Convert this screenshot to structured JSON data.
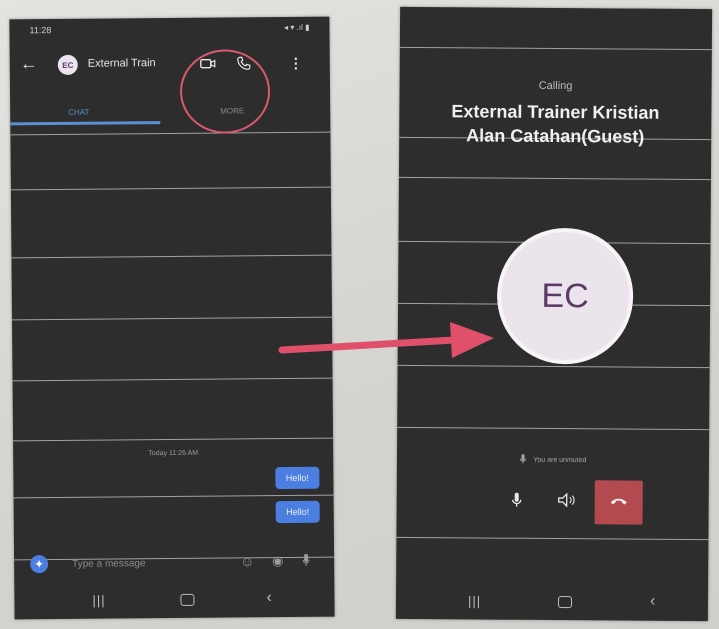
{
  "chat_screen": {
    "status_time": "11:28",
    "status_icons": "◂ ▾ .ıl ▮",
    "avatar_initials": "EC",
    "contact_name": "External Train",
    "tabs": [
      {
        "label": "CHAT"
      },
      {
        "label": "MORE"
      }
    ],
    "date_label": "Today 11:26 AM",
    "messages": [
      {
        "text": "Hello!"
      },
      {
        "text": "Hello!"
      }
    ],
    "composer_placeholder": "Type a message"
  },
  "call_screen": {
    "status_text": "Calling",
    "callee_line1": "External Trainer Kristian",
    "callee_line2": "Alan Catahan(Guest)",
    "avatar_initials": "EC",
    "mute_status": "You are unmuted"
  },
  "colors": {
    "accent_blue": "#4a7ee0",
    "highlight_red": "#d95a6c",
    "arrow_red": "#e0506a",
    "hangup_red": "#b34a4f",
    "screen_bg": "#2d2d2d"
  },
  "icons": {
    "back": "back-arrow-icon",
    "video": "video-call-icon",
    "audio": "audio-call-icon",
    "more": "more-vertical-icon",
    "mic": "microphone-icon",
    "speaker": "speaker-icon",
    "hangup": "hang-up-icon"
  }
}
